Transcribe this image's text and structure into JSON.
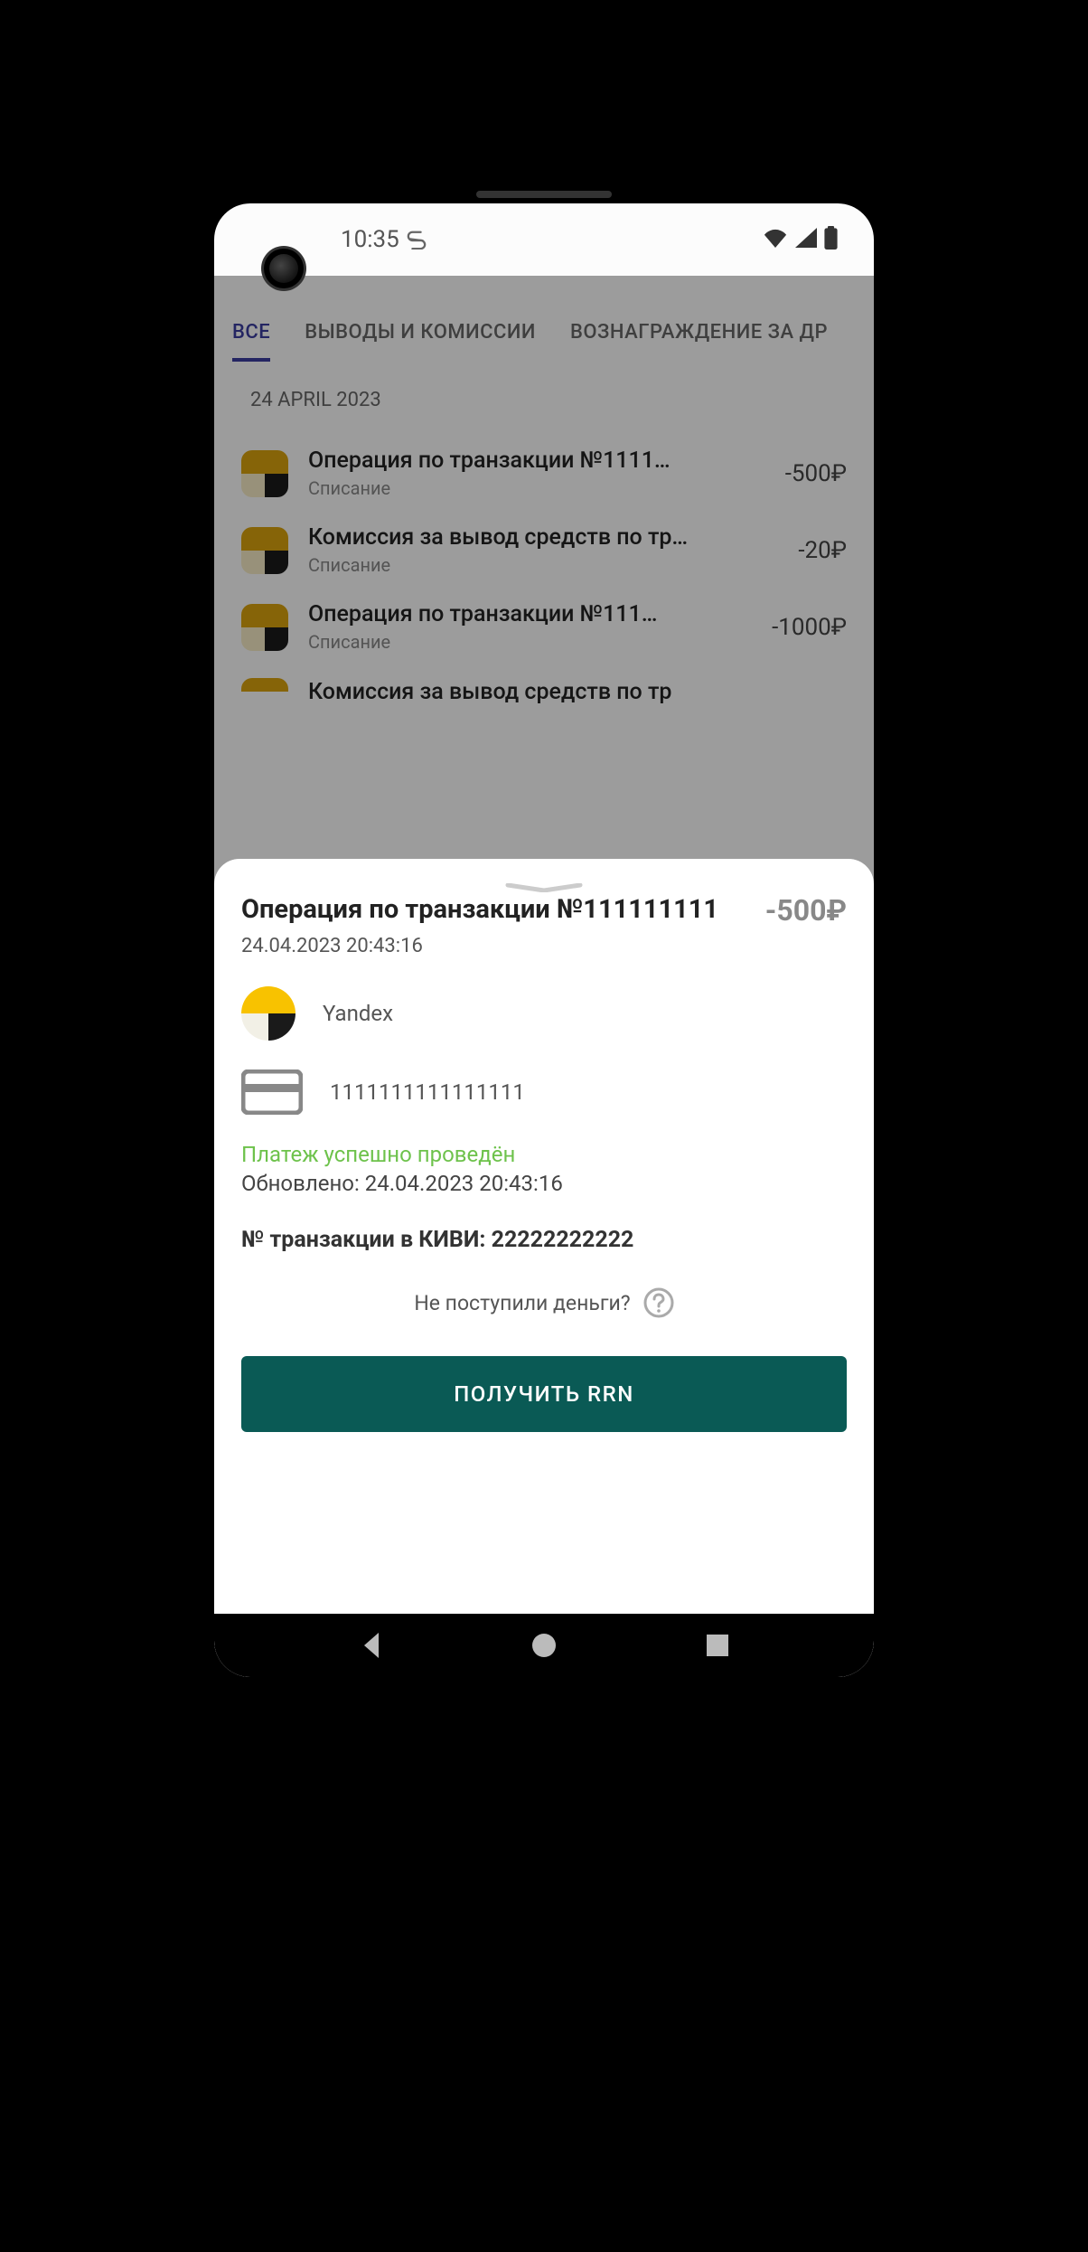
{
  "status_bar": {
    "time": "10:35"
  },
  "tabs": [
    {
      "label": "ВСЕ",
      "active": true
    },
    {
      "label": "ВЫВОДЫ И КОМИССИИ",
      "active": false
    },
    {
      "label": "ВОЗНАГРАЖДЕНИЕ ЗА ДР",
      "active": false
    }
  ],
  "date_header": "24 APRIL 2023",
  "transactions": [
    {
      "title": "Операция по транзакции №1111…",
      "subtitle": "Списание",
      "amount": "-500₽"
    },
    {
      "title": "Комиссия за вывод средств по тр…",
      "subtitle": "Списание",
      "amount": "-20₽"
    },
    {
      "title": "Операция по транзакции №111…",
      "subtitle": "Списание",
      "amount": "-1000₽"
    },
    {
      "title": "Комиссия за вывод средств по тр",
      "subtitle": "",
      "amount": ""
    }
  ],
  "sheet": {
    "title": "Операция по транзакции №111111111",
    "amount": "-500₽",
    "datetime": "24.04.2023 20:43:16",
    "merchant": "Yandex",
    "card_number": "1111111111111111",
    "status_success": "Платеж успешно проведён",
    "status_updated": "Обновлено: 24.04.2023 20:43:16",
    "qiwi_label": "№ транзакции в КИВИ: ",
    "qiwi_value": "22222222222",
    "help_text": "Не поступили деньги?",
    "cta_label": "ПОЛУЧИТЬ RRN"
  }
}
